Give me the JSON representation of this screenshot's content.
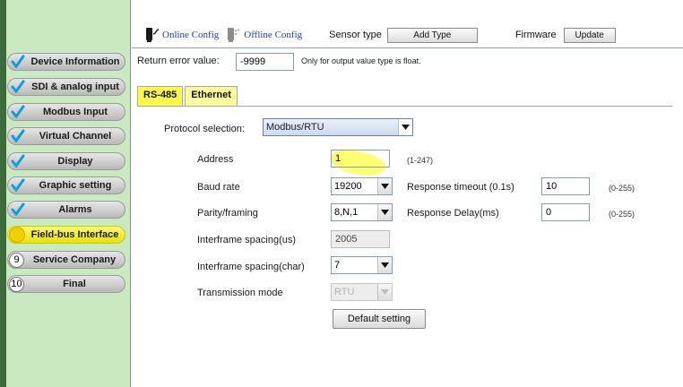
{
  "sidebar": {
    "items": [
      {
        "label": "Device Information",
        "marker": "check"
      },
      {
        "label": "SDI & analog input",
        "marker": "check"
      },
      {
        "label": "Modbus Input",
        "marker": "check"
      },
      {
        "label": "Virtual Channel",
        "marker": "check"
      },
      {
        "label": "Display",
        "marker": "check"
      },
      {
        "label": "Graphic setting",
        "marker": "check"
      },
      {
        "label": "Alarms",
        "marker": "check"
      },
      {
        "label": "Field-bus Interface",
        "marker": "active-dot"
      },
      {
        "label": "Service Company",
        "marker": "9"
      },
      {
        "label": "Final",
        "marker": "10"
      }
    ]
  },
  "toolbar": {
    "online_config": "Online Config",
    "offline_config": "Offline Config",
    "sensor_type_label": "Sensor type",
    "add_type_button": "Add Type",
    "firmware_label": "Firmware",
    "update_button": "Update"
  },
  "return_error": {
    "label": "Return error value:",
    "value": "-9999",
    "note": "Only for output value type is float."
  },
  "tabs": [
    {
      "label": "RS-485",
      "selected": true
    },
    {
      "label": "Ethernet",
      "selected": false
    }
  ],
  "protocol": {
    "label": "Protocol selection:",
    "value": "Modbus/RTU"
  },
  "fields": {
    "address": {
      "label": "Address",
      "value": "1",
      "range": "(1-247)"
    },
    "baud_rate": {
      "label": "Baud rate",
      "value": "19200"
    },
    "parity": {
      "label": "Parity/framing",
      "value": "8,N,1"
    },
    "interframe_us": {
      "label": "Interframe spacing(us)",
      "value": "2005"
    },
    "interframe_char": {
      "label": "Interframe spacing(char)",
      "value": "7"
    },
    "transmission_mode": {
      "label": "Transmission mode",
      "value": "RTU"
    },
    "response_timeout": {
      "label": "Response timeout (0.1s)",
      "value": "10",
      "range": "(0-255)"
    },
    "response_delay": {
      "label": "Response Delay(ms)",
      "value": "0",
      "range": "(0-255)"
    }
  },
  "default_setting_button": "Default setting",
  "colors": {
    "sidebar_bg": "#c9e9c0",
    "active_item": "#fff200",
    "check": "#0aa0e0",
    "link": "#1a3cc8",
    "tab_highlight": "#fff94a"
  }
}
